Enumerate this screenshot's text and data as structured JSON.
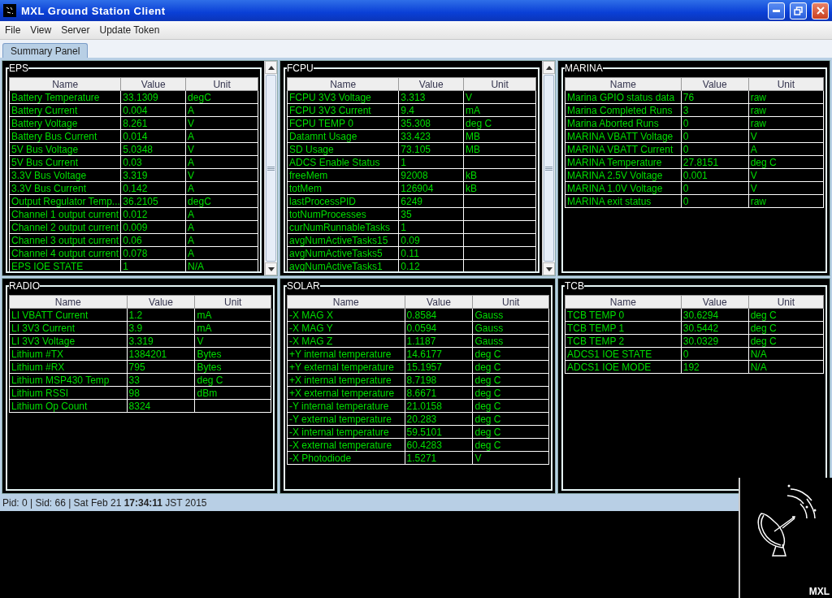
{
  "window": {
    "title": "MXL Ground Station Client"
  },
  "menu": [
    "File",
    "View",
    "Server",
    "Update Token"
  ],
  "tabs": [
    {
      "label": "Summary Panel",
      "selected": true
    }
  ],
  "panels": [
    {
      "title": "EPS",
      "scrollable": true,
      "columns": [
        "Name",
        "Value",
        "Unit"
      ],
      "rows": [
        [
          "Battery Temperature",
          "33.1309",
          "degC"
        ],
        [
          "Battery Current",
          "0.004",
          "A"
        ],
        [
          "Battery Voltage",
          "8.261",
          "V"
        ],
        [
          "Battery Bus Current",
          "0.014",
          "A"
        ],
        [
          "5V Bus Voltage",
          "5.0348",
          "V"
        ],
        [
          "5V Bus Current",
          "0.03",
          "A"
        ],
        [
          "3.3V Bus Voltage",
          "3.319",
          "V"
        ],
        [
          "3.3V Bus Current",
          "0.142",
          "A"
        ],
        [
          "Output Regulator Temp...",
          "36.2105",
          "degC"
        ],
        [
          "Channel 1 output current",
          "0.012",
          "A"
        ],
        [
          "Channel 2 output current",
          "0.009",
          "A"
        ],
        [
          "Channel 3 output current",
          "0.06",
          "A"
        ],
        [
          "Channel 4 output current",
          "0.078",
          "A"
        ],
        [
          "EPS IOE STATE",
          "1",
          "N/A"
        ]
      ]
    },
    {
      "title": "FCPU",
      "scrollable": true,
      "columns": [
        "Name",
        "Value",
        "Unit"
      ],
      "rows": [
        [
          "FCPU 3V3 Voltage",
          "3.313",
          "V"
        ],
        [
          "FCPU 3V3 Current",
          "9.4",
          "mA"
        ],
        [
          "FCPU TEMP 0",
          "35.308",
          "deg C"
        ],
        [
          "Datamnt Usage",
          "33.423",
          "MB"
        ],
        [
          "SD Usage",
          "73.105",
          "MB"
        ],
        [
          "ADCS Enable Status",
          "1",
          ""
        ],
        [
          "freeMem",
          "92008",
          "kB"
        ],
        [
          "totMem",
          "126904",
          "kB"
        ],
        [
          "lastProcessPID",
          "6249",
          ""
        ],
        [
          "totNumProcesses",
          "35",
          ""
        ],
        [
          "curNumRunnableTasks",
          "1",
          ""
        ],
        [
          "avgNumActiveTasks15",
          "0.09",
          ""
        ],
        [
          "avgNumActiveTasks5",
          "0.11",
          ""
        ],
        [
          "avgNumActiveTasks1",
          "0.12",
          ""
        ]
      ]
    },
    {
      "title": "MARINA",
      "scrollable": false,
      "columns": [
        "Name",
        "Value",
        "Unit"
      ],
      "rows": [
        [
          "Marina GPIO status data",
          "76",
          "raw"
        ],
        [
          "Marina Completed Runs",
          "3",
          "raw"
        ],
        [
          "Marina Aborted Runs",
          "0",
          "raw"
        ],
        [
          "MARINA VBATT Voltage",
          "0",
          "V"
        ],
        [
          "MARINA VBATT Current",
          "0",
          "A"
        ],
        [
          "MARINA Temperature",
          "27.8151",
          "deg C"
        ],
        [
          "MARINA 2.5V Voltage",
          "0.001",
          "V"
        ],
        [
          "MARINA 1.0V Voltage",
          "0",
          "V"
        ],
        [
          "MARINA exit status",
          "0",
          "raw"
        ]
      ]
    },
    {
      "title": "RADIO",
      "scrollable": false,
      "columns": [
        "Name",
        "Value",
        "Unit"
      ],
      "rows": [
        [
          "LI VBATT Current",
          "1.2",
          "mA"
        ],
        [
          "LI 3V3 Current",
          "3.9",
          "mA"
        ],
        [
          "LI 3V3 Voltage",
          "3.319",
          "V"
        ],
        [
          "Lithium #TX",
          "1384201",
          "Bytes"
        ],
        [
          "Lithium #RX",
          "795",
          "Bytes"
        ],
        [
          "Lithium MSP430 Temp",
          "33",
          "deg C"
        ],
        [
          "Lithium RSSI",
          "98",
          "dBm"
        ],
        [
          "Lithium Op Count",
          "8324",
          ""
        ]
      ]
    },
    {
      "title": "SOLAR",
      "scrollable": false,
      "columns": [
        "Name",
        "Value",
        "Unit"
      ],
      "rows": [
        [
          "-X MAG X",
          "0.8584",
          "Gauss"
        ],
        [
          "-X MAG Y",
          "0.0594",
          "Gauss"
        ],
        [
          "-X MAG Z",
          "1.1187",
          "Gauss"
        ],
        [
          "+Y internal temperature",
          "14.6177",
          "deg C"
        ],
        [
          "+Y external temperature",
          "15.1957",
          "deg C"
        ],
        [
          "+X internal temperature",
          "8.7198",
          "deg C"
        ],
        [
          "+X external temperature",
          "8.6671",
          "deg C"
        ],
        [
          "-Y internal temperature",
          "21.0158",
          "deg C"
        ],
        [
          "-Y external temperature",
          "20.283",
          "deg C"
        ],
        [
          "-X internal temperature",
          "59.5101",
          "deg C"
        ],
        [
          "-X external temperature",
          "60.4283",
          "deg C"
        ],
        [
          "-X Photodiode",
          "1.5271",
          "V"
        ]
      ]
    },
    {
      "title": "TCB",
      "scrollable": false,
      "columns": [
        "Name",
        "Value",
        "Unit"
      ],
      "rows": [
        [
          "TCB TEMP 0",
          "30.6294",
          "deg C"
        ],
        [
          "TCB TEMP 1",
          "30.5442",
          "deg C"
        ],
        [
          "TCB TEMP 2",
          "30.0329",
          "deg C"
        ],
        [
          "ADCS1 IOE STATE",
          "0",
          "N/A"
        ],
        [
          "ADCS1 IOE MODE",
          "192",
          "N/A"
        ]
      ]
    }
  ],
  "status_bar": "Pid: 0 | Sid: 66 | Sat Feb 21 **17:34:11** JST 2015",
  "logo": {
    "text": "MXL"
  }
}
